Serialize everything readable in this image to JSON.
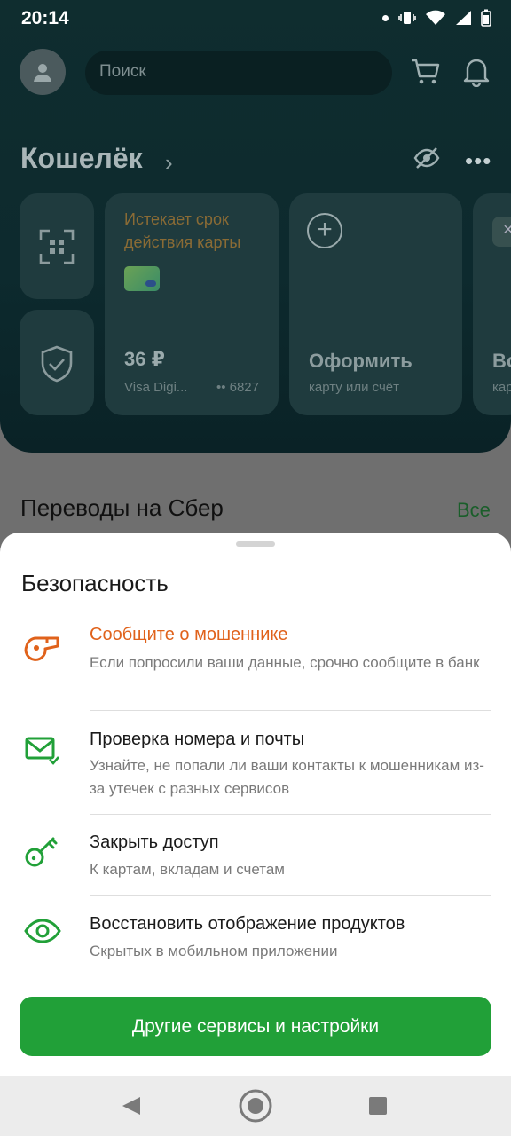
{
  "status_bar": {
    "time": "20:14"
  },
  "header": {
    "search_placeholder": "Поиск"
  },
  "wallet": {
    "title": "Кошелёк",
    "card": {
      "expiring_label": "Истекает срок действия карты",
      "balance": "36 ₽",
      "name": "Visa Digi...",
      "number": "•• 6827"
    },
    "add_tile": {
      "title": "Оформить",
      "subtitle": "карту или счёт"
    },
    "partial_tile": {
      "title": "Во",
      "subtitle": "кар"
    }
  },
  "transfers": {
    "title": "Переводы на Сбер",
    "all_label": "Все"
  },
  "sheet": {
    "title": "Безопасность",
    "items": [
      {
        "title": "Сообщите о мошеннике",
        "subtitle": "Если попросили ваши данные, срочно сообщите в банк",
        "icon": "whistle-icon"
      },
      {
        "title": "Проверка номера и почты",
        "subtitle": "Узнайте, не попали ли ваши контакты к мошенникам из-за утечек с разных сервисов",
        "icon": "mail-check-icon"
      },
      {
        "title": "Закрыть доступ",
        "subtitle": "К картам, вкладам и счетам",
        "icon": "key-icon"
      },
      {
        "title": "Восстановить отображение продуктов",
        "subtitle": "Скрытых в мобильном приложении",
        "icon": "eye-icon"
      }
    ],
    "button_label": "Другие сервисы и настройки"
  },
  "colors": {
    "accent_green": "#21a038",
    "warning_orange": "#e0621b",
    "icon_green": "#21a038"
  }
}
